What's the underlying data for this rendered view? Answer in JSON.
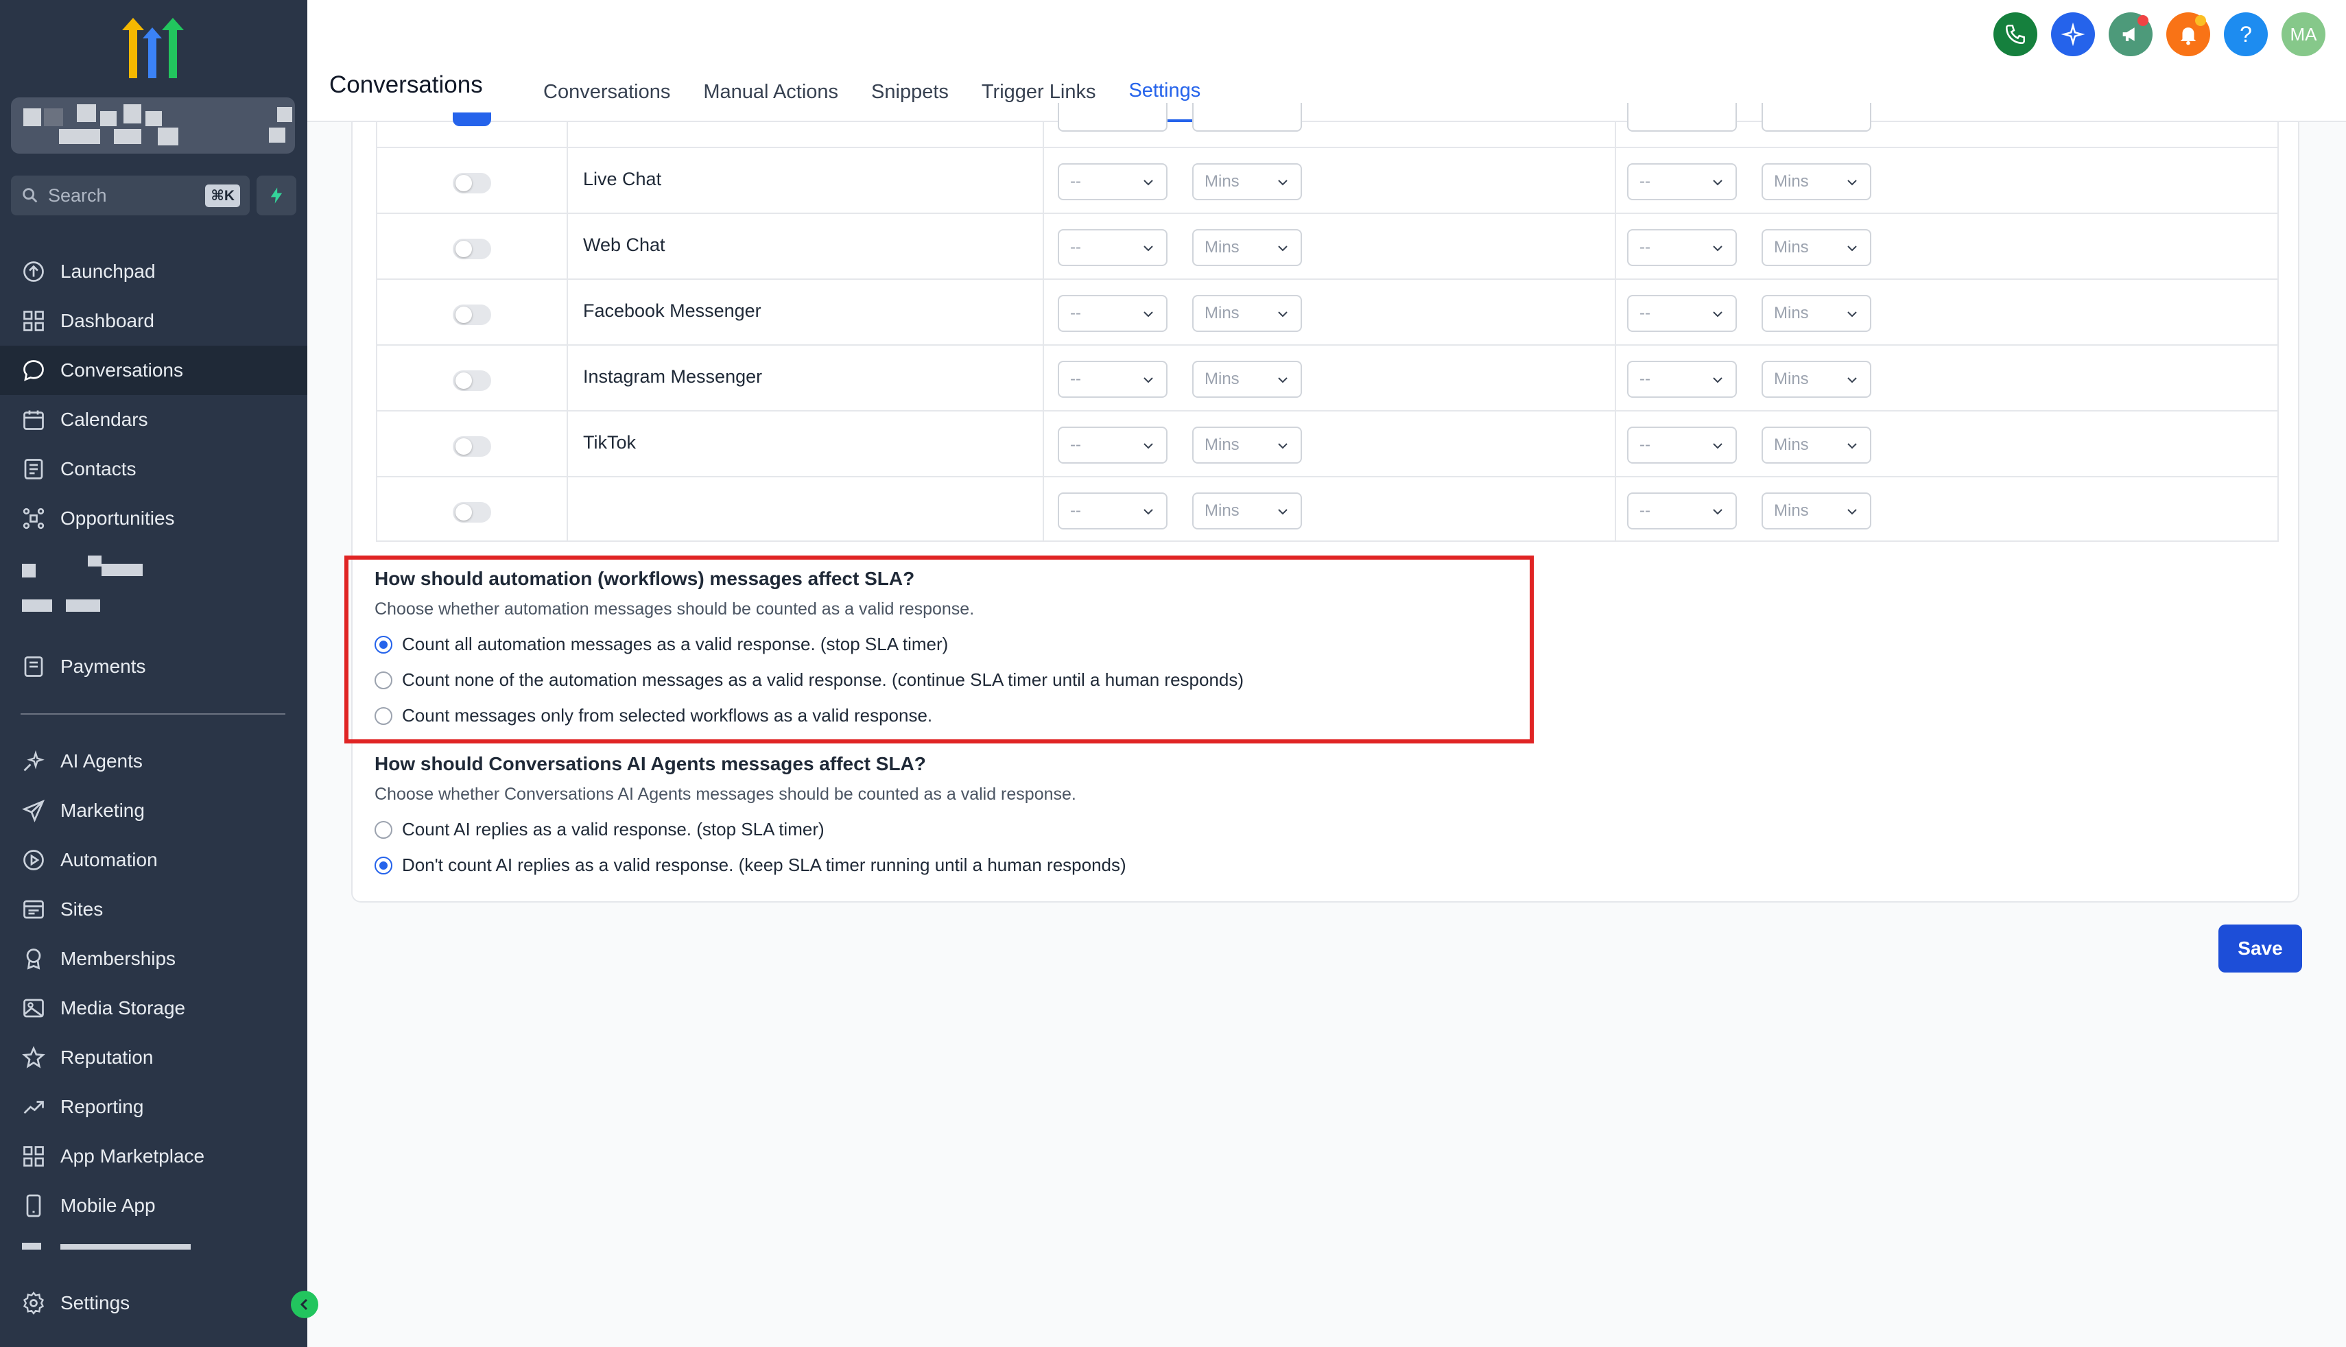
{
  "sidebar": {
    "search": {
      "placeholder": "Search",
      "shortcut": "⌘K"
    },
    "items": [
      {
        "label": "Launchpad",
        "icon": "launchpad-icon"
      },
      {
        "label": "Dashboard",
        "icon": "dashboard-icon"
      },
      {
        "label": "Conversations",
        "icon": "chat-icon",
        "active": true
      },
      {
        "label": "Calendars",
        "icon": "calendar-icon"
      },
      {
        "label": "Contacts",
        "icon": "contacts-icon"
      },
      {
        "label": "Opportunities",
        "icon": "opportunities-icon"
      },
      {
        "label": "Payments",
        "icon": "payments-icon"
      },
      {
        "label": "AI Agents",
        "icon": "sparkle-icon"
      },
      {
        "label": "Marketing",
        "icon": "send-icon"
      },
      {
        "label": "Automation",
        "icon": "automation-icon"
      },
      {
        "label": "Sites",
        "icon": "sites-icon"
      },
      {
        "label": "Memberships",
        "icon": "memberships-icon"
      },
      {
        "label": "Media Storage",
        "icon": "media-icon"
      },
      {
        "label": "Reputation",
        "icon": "star-icon"
      },
      {
        "label": "Reporting",
        "icon": "trend-icon"
      },
      {
        "label": "App Marketplace",
        "icon": "apps-icon"
      },
      {
        "label": "Mobile App",
        "icon": "mobile-icon"
      },
      {
        "label": "Settings",
        "icon": "gear-icon"
      }
    ]
  },
  "header": {
    "title": "Conversations",
    "tabs": [
      "Conversations",
      "Manual Actions",
      "Snippets",
      "Trigger Links",
      "Settings"
    ],
    "active_tab": "Settings",
    "avatar_initials": "MA",
    "help_label": "?"
  },
  "sla_table": {
    "rows": [
      {
        "channel": "Live Chat"
      },
      {
        "channel": "Web Chat"
      },
      {
        "channel": "Facebook Messenger"
      },
      {
        "channel": "Instagram Messenger"
      },
      {
        "channel": "TikTok"
      },
      {
        "channel": ""
      }
    ],
    "value_placeholder": "--",
    "unit_placeholder": "Mins"
  },
  "automation_section": {
    "question": "How should automation (workflows) messages affect SLA?",
    "description": "Choose whether automation messages should be counted as a valid response.",
    "options": [
      "Count all automation messages as a valid response. (stop SLA timer)",
      "Count none of the automation messages as a valid response. (continue SLA timer until a human responds)",
      "Count messages only from selected workflows as a valid response."
    ],
    "selected_index": 0
  },
  "ai_section": {
    "question": "How should Conversations AI Agents messages affect SLA?",
    "description": "Choose whether Conversations AI Agents messages should be counted as a valid response.",
    "options": [
      "Count AI replies as a valid response. (stop SLA timer)",
      "Don't count AI replies as a valid response. (keep SLA timer running until a human responds)"
    ],
    "selected_index": 1
  },
  "save_label": "Save",
  "colors": {
    "sidebar_bg": "#2a3547",
    "accent": "#2563eb",
    "highlight_border": "#e02424"
  }
}
